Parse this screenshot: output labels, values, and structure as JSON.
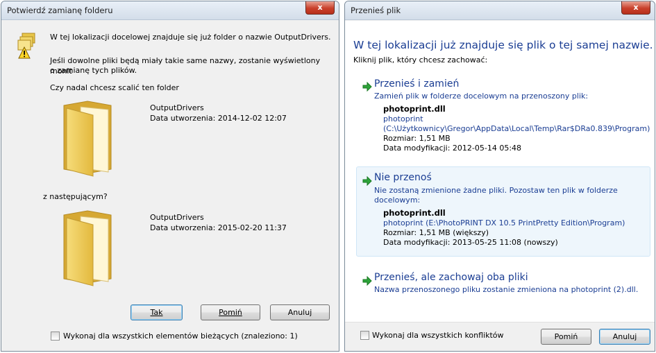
{
  "merge_dialog": {
    "title": "Potwierdź zamianę folderu",
    "close_label": "x",
    "message": "W tej lokalizacji docelowej znajduje się już folder o nazwie OutputDrivers.",
    "detail_line1": "Jeśli dowolne pliki będą miały takie same nazwy, zostanie wyświetlony monit",
    "detail_line2": "o zamianę tych plików.",
    "question": "Czy nadal chcesz scalić ten folder",
    "folder1": {
      "name": "OutputDrivers",
      "created": "Data utworzenia: 2014-12-02 12:07"
    },
    "with_label": "z następującym?",
    "folder2": {
      "name": "OutputDrivers",
      "created": "Data utworzenia: 2015-02-20 11:37"
    },
    "yes_label": "Tak",
    "skip_label": "Pomiń",
    "cancel_label": "Anuluj",
    "apply_all_label": "Wykonaj dla wszystkich elementów bieżących (znaleziono: 1)"
  },
  "move_dialog": {
    "title": "Przenieś plik",
    "close_label": "x",
    "heading": "W tej lokalizacji już znajduje się plik o tej samej nazwie.",
    "subheading": "Kliknij plik, który chcesz zachować:",
    "option_replace": {
      "title": "Przenieś i zamień",
      "description": "Zamień plik w folderze docelowym na przenoszony plik:",
      "file_name": "photoprint.dll",
      "file_desc": "photoprint",
      "file_path": "(C:\\Użytkownicy\\Gregor\\AppData\\Local\\Temp\\Rar$DRa0.839\\Program)",
      "size": "Rozmiar: 1,51 MB",
      "modified": "Data modyfikacji: 2012-05-14 05:48"
    },
    "option_keep": {
      "title": "Nie przenoś",
      "description_line1": "Nie zostaną zmienione żadne pliki. Pozostaw ten plik w folderze",
      "description_line2": "docelowym:",
      "file_name": "photoprint.dll",
      "file_path": "photoprint (E:\\PhotoPRINT DX 10.5 PrintPretty Edition\\Program)",
      "size": "Rozmiar: 1,51 MB (większy)",
      "modified": "Data modyfikacji: 2013-05-25 11:08 (nowszy)"
    },
    "option_both": {
      "title": "Przenieś, ale zachowaj oba pliki",
      "description": "Nazwa przenoszonego pliku zostanie zmieniona na photoprint (2).dll."
    },
    "apply_all_label": "Wykonaj dla wszystkich konfliktów",
    "skip_label": "Pomiń",
    "cancel_label": "Anuluj"
  }
}
